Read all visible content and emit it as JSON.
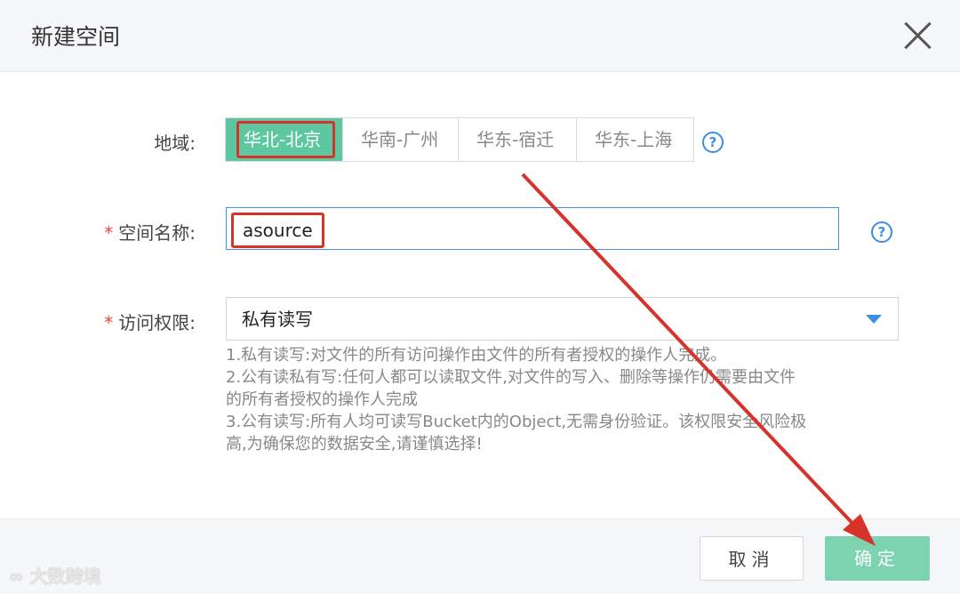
{
  "dialog": {
    "title": "新建空间",
    "close_icon": "close-icon"
  },
  "form": {
    "region": {
      "label": "地域:",
      "options": [
        "华北-北京",
        "华南-广州",
        "华东-宿迁",
        "华东-上海"
      ],
      "selected_index": 0,
      "help_icon": "question-circle-icon",
      "help_text": "?"
    },
    "space_name": {
      "required_mark": "*",
      "label": "空间名称:",
      "value": "asource",
      "help_icon": "question-circle-icon",
      "help_text": "?"
    },
    "access": {
      "required_mark": "*",
      "label": "访问权限:",
      "value": "私有读写",
      "description": [
        "1.私有读写:对文件的所有访问操作由文件的所有者授权的操作人完成。",
        "2.公有读私有写:任何人都可以读取文件,对文件的写入、删除等操作仍需要由文件",
        "的所有者授权的操作人完成",
        "3.公有读写:所有人均可读写Bucket内的Object,无需身份验证。该权限安全风险极",
        "高,为确保您的数据安全,请谨慎选择!"
      ]
    }
  },
  "footer": {
    "cancel_label": "取消",
    "ok_label": "确定"
  },
  "watermark": "大数跨境",
  "colors": {
    "accent_green": "#5cc7a0",
    "ok_button": "#7dd3b0",
    "highlight_red": "#d6332a",
    "link_blue": "#3a8ee6"
  }
}
